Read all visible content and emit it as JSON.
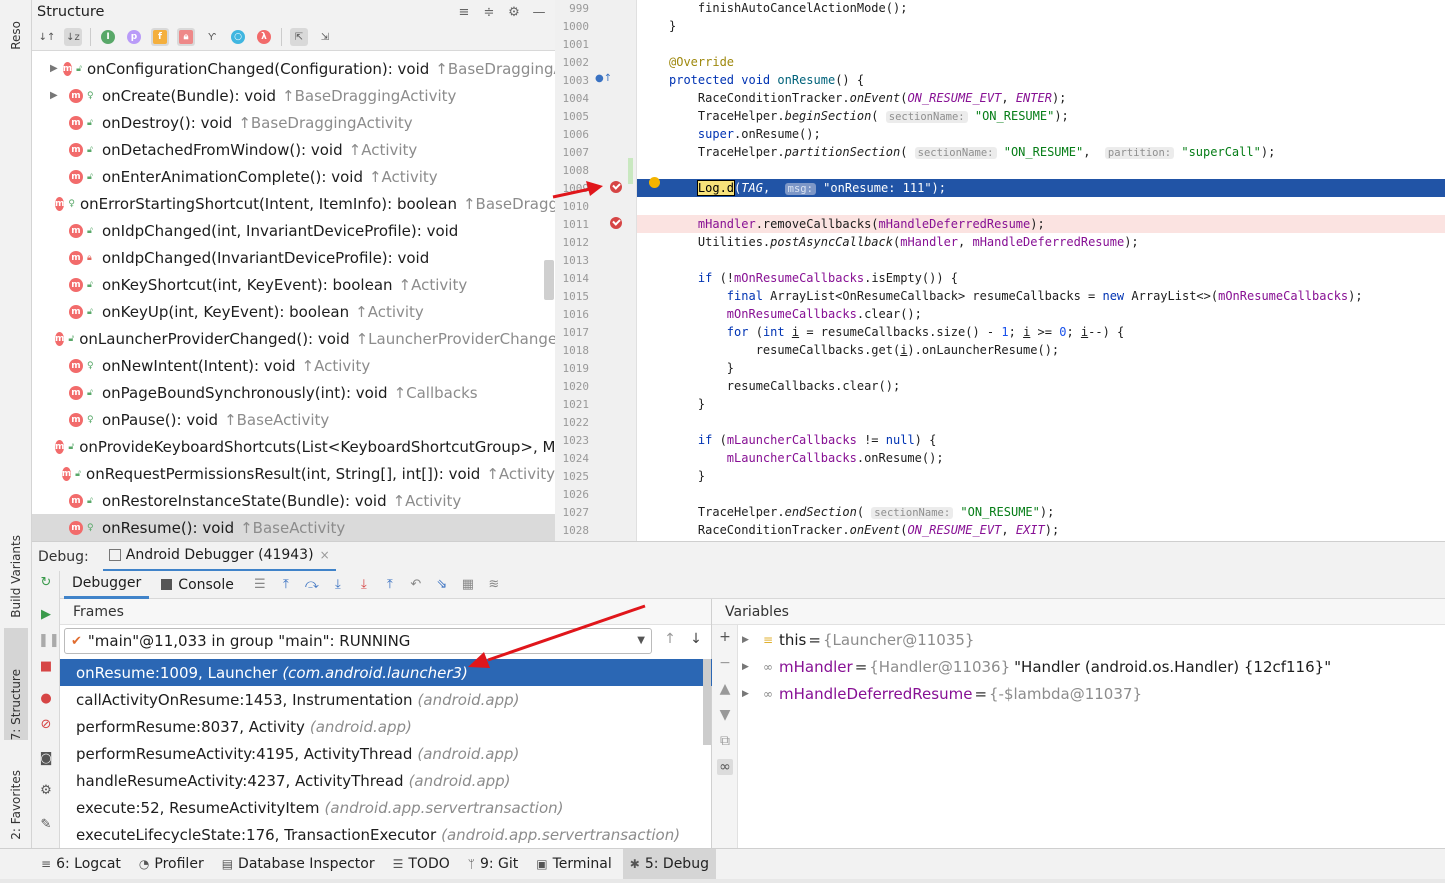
{
  "left_tool_tabs": [
    {
      "label": "Reso",
      "id": "resource-manager"
    },
    {
      "label": "Build Variants",
      "id": "build-variants"
    },
    {
      "label": "7: Structure",
      "id": "structure"
    },
    {
      "label": "2: Favorites",
      "id": "favorites"
    }
  ],
  "structure": {
    "title": "Structure",
    "toolbar_icons": [
      "sort-visibility-icon",
      "sort-alpha-icon",
      "inherited-icon",
      "properties-icon",
      "fields-icon",
      "non-public-icon",
      "lambdas-icon",
      "anonymous-icon",
      "lambda-icon",
      "autoscroll-to-source-icon",
      "autoscroll-from-source-icon"
    ],
    "items": [
      {
        "sig": "onConfigurationChanged(Configuration): void",
        "super": "↑BaseDraggingActivity",
        "expandable": true,
        "vis": "public"
      },
      {
        "sig": "onCreate(Bundle): void",
        "super": "↑BaseDraggingActivity",
        "expandable": true,
        "vis": "protected"
      },
      {
        "sig": "onDestroy(): void",
        "super": "↑BaseDraggingActivity",
        "expandable": false,
        "vis": "public"
      },
      {
        "sig": "onDetachedFromWindow(): void",
        "super": "↑Activity",
        "expandable": false,
        "vis": "public"
      },
      {
        "sig": "onEnterAnimationComplete(): void",
        "super": "↑Activity",
        "expandable": false,
        "vis": "public"
      },
      {
        "sig": "onErrorStartingShortcut(Intent, ItemInfo): boolean",
        "super": "↑BaseDraggi",
        "expandable": false,
        "vis": "protected"
      },
      {
        "sig": "onIdpChanged(int, InvariantDeviceProfile): void",
        "super": "",
        "expandable": false,
        "vis": "public"
      },
      {
        "sig": "onIdpChanged(InvariantDeviceProfile): void",
        "super": "",
        "expandable": false,
        "vis": "private"
      },
      {
        "sig": "onKeyShortcut(int, KeyEvent): boolean",
        "super": "↑Activity",
        "expandable": false,
        "vis": "public"
      },
      {
        "sig": "onKeyUp(int, KeyEvent): boolean",
        "super": "↑Activity",
        "expandable": false,
        "vis": "public"
      },
      {
        "sig": "onLauncherProviderChanged(): void",
        "super": "↑LauncherProviderChangeL",
        "expandable": false,
        "vis": "public"
      },
      {
        "sig": "onNewIntent(Intent): void",
        "super": "↑Activity",
        "expandable": false,
        "vis": "protected"
      },
      {
        "sig": "onPageBoundSynchronously(int): void",
        "super": "↑Callbacks",
        "expandable": false,
        "vis": "public"
      },
      {
        "sig": "onPause(): void",
        "super": "↑BaseActivity",
        "expandable": false,
        "vis": "protected"
      },
      {
        "sig": "onProvideKeyboardShortcuts(List<KeyboardShortcutGroup>, Me",
        "super": "",
        "expandable": false,
        "vis": "public"
      },
      {
        "sig": "onRequestPermissionsResult(int, String[], int[]): void",
        "super": "↑Activity",
        "expandable": false,
        "vis": "public"
      },
      {
        "sig": "onRestoreInstanceState(Bundle): void",
        "super": "↑Activity",
        "expandable": false,
        "vis": "public"
      },
      {
        "sig": "onResume(): void",
        "super": "↑BaseActivity",
        "expandable": false,
        "vis": "protected",
        "selected": true
      }
    ]
  },
  "editor": {
    "line_numbers": [
      "999",
      "1000",
      "1001",
      "1002",
      "1003",
      "1004",
      "1005",
      "1006",
      "1007",
      "1008",
      "1009",
      "1010",
      "1011",
      "1012",
      "1013",
      "1014",
      "1015",
      "1016",
      "1017",
      "1018",
      "1019",
      "1020",
      "1021",
      "1022",
      "1023",
      "1024",
      "1025",
      "1026",
      "1027",
      "1028"
    ],
    "breakpoint_lines": [
      "1009",
      "1011"
    ],
    "current_line": "1009"
  },
  "debug": {
    "label": "Debug:",
    "session_tab": "Android Debugger (41943)",
    "tabs": [
      "Debugger",
      "Console"
    ],
    "frames_title": "Frames",
    "thread": "\"main\"@11,033 in group \"main\": RUNNING",
    "frames": [
      {
        "method": "onResume:1009, Launcher",
        "pkg": "(com.android.launcher3)",
        "selected": true
      },
      {
        "method": "callActivityOnResume:1453, Instrumentation",
        "pkg": "(android.app)"
      },
      {
        "method": "performResume:8037, Activity",
        "pkg": "(android.app)"
      },
      {
        "method": "performResumeActivity:4195, ActivityThread",
        "pkg": "(android.app)"
      },
      {
        "method": "handleResumeActivity:4237, ActivityThread",
        "pkg": "(android.app)"
      },
      {
        "method": "execute:52, ResumeActivityItem",
        "pkg": "(android.app.servertransaction)"
      },
      {
        "method": "executeLifecycleState:176, TransactionExecutor",
        "pkg": "(android.app.servertransaction)"
      }
    ],
    "variables_title": "Variables",
    "variables": [
      {
        "name": "this",
        "value": "{Launcher@11035}",
        "text": "",
        "expandable": true,
        "icon": "field-icon"
      },
      {
        "name": "mHandler",
        "value": "{Handler@11036}",
        "text": "\"Handler (android.os.Handler) {12cf116}\"",
        "expandable": true,
        "icon": "watch-glasses-icon"
      },
      {
        "name": "mHandleDeferredResume",
        "value": "{-$lambda@11037}",
        "text": "",
        "expandable": true,
        "icon": "watch-glasses-icon"
      }
    ]
  },
  "bottom_tabs": [
    {
      "label": "6: Logcat",
      "icon": "≡"
    },
    {
      "label": "Profiler",
      "icon": "◔"
    },
    {
      "label": "Database Inspector",
      "icon": "▤"
    },
    {
      "label": "TODO",
      "icon": "☰"
    },
    {
      "label": "9: Git",
      "icon": "ᛘ"
    },
    {
      "label": "Terminal",
      "icon": "▣"
    },
    {
      "label": "5: Debug",
      "icon": "✱",
      "active": true
    }
  ],
  "colors": {
    "exec_line": "#2154a6",
    "frame_selected": "#2b67b4",
    "breakpoint": "#d64545",
    "annotation_arrow": "#e0161b"
  }
}
